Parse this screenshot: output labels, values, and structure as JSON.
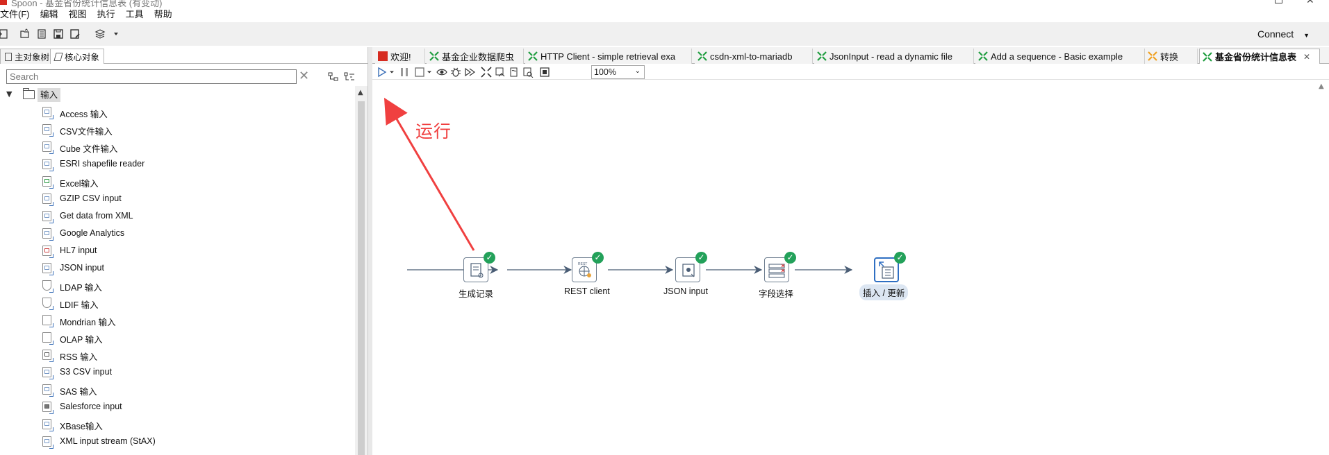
{
  "window": {
    "title": "Spoon - 基金省份统计信息表 (有变动)"
  },
  "menu": [
    "文件(F)",
    "编辑",
    "视图",
    "执行",
    "工具",
    "帮助"
  ],
  "toolbar": {
    "connect_label": "Connect"
  },
  "left_panel": {
    "tabs": [
      "主对象树",
      "核心对象"
    ],
    "search_placeholder": "Search",
    "tree_root_label": "输入",
    "items": [
      "Access 输入",
      "CSV文件输入",
      "Cube 文件输入",
      "ESRI shapefile reader",
      "Excel输入",
      "GZIP CSV input",
      "Get data from XML",
      "Google Analytics",
      "HL7 input",
      "JSON input",
      "LDAP 输入",
      "LDIF 输入",
      "Mondrian 输入",
      "OLAP 输入",
      "RSS 输入",
      "S3 CSV input",
      "SAS 输入",
      "Salesforce input",
      "XBase输入",
      "XML input stream (StAX)"
    ]
  },
  "editor": {
    "tabs": [
      "欢迎!",
      "基金企业数据爬虫",
      "HTTP Client - simple retrieval exa",
      "csdn-xml-to-mariadb",
      "JsonInput - read a dynamic file",
      "Add a sequence - Basic example",
      "转换",
      "基金省份统计信息表"
    ],
    "active_tab_index": 7,
    "zoom": "100%",
    "annotation_text": "运行",
    "steps": [
      "生成记录",
      "REST client",
      "JSON input",
      "字段选择",
      "插入 / 更新"
    ],
    "selected_step_index": 4
  },
  "colors": {
    "accent": "#2f6fc2",
    "ok": "#23a15a",
    "annotation": "#f04040",
    "hop": "#4a5d75"
  }
}
